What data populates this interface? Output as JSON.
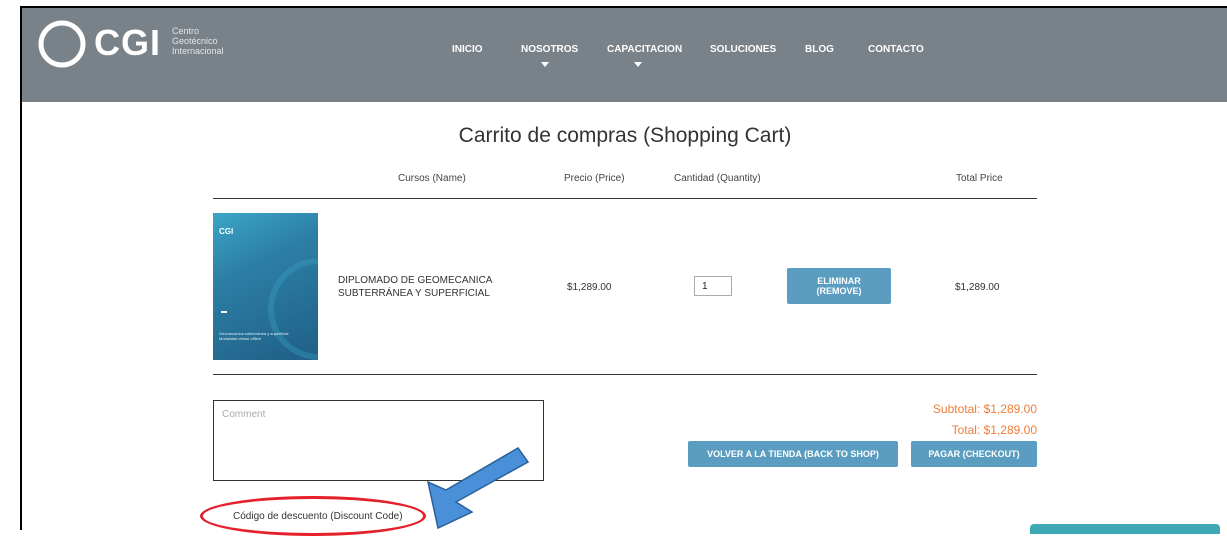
{
  "header": {
    "logo_text": "CGI",
    "logo_sub": [
      "Centro",
      "Geotécnico",
      "Internacional"
    ],
    "nav": [
      "INICIO",
      "NOSOTROS",
      "CAPACITACION",
      "SOLUCIONES",
      "BLOG",
      "CONTACTO"
    ]
  },
  "cart": {
    "title": "Carrito de compras (Shopping Cart)",
    "columns": {
      "name": "Cursos (Name)",
      "price": "Precio (Price)",
      "quantity": "Cantidad (Quantity)",
      "total": "Total Price"
    },
    "item": {
      "name_line1": "DIPLOMADO DE GEOMECANICA",
      "name_line2": "SUBTERRÁNEA Y SUPERFICIAL",
      "price": "$1,289.00",
      "quantity": "1",
      "remove_line1": "ELIMINAR",
      "remove_line2": "(REMOVE)",
      "total": "$1,289.00",
      "thumb_logo": "CGI",
      "thumb_caption1": "Geomecanica subterránea y superficial",
      "thumb_caption2": "Modalidad virtual offline"
    },
    "comment_placeholder": "Comment",
    "subtotal": "Subtotal: $1,289.00",
    "total": "Total: $1,289.00",
    "back_button": "VOLVER A LA TIENDA (BACK TO SHOP)",
    "checkout_button": "PAGAR (CHECKOUT)",
    "discount_label": "Código de descuento (Discount Code)"
  },
  "colors": {
    "header_bg": "#7a8289",
    "button": "#5b9dc0",
    "price_accent": "#ef7d3a",
    "annotation_red": "#e5202a",
    "annotation_arrow": "#4a90d9"
  }
}
